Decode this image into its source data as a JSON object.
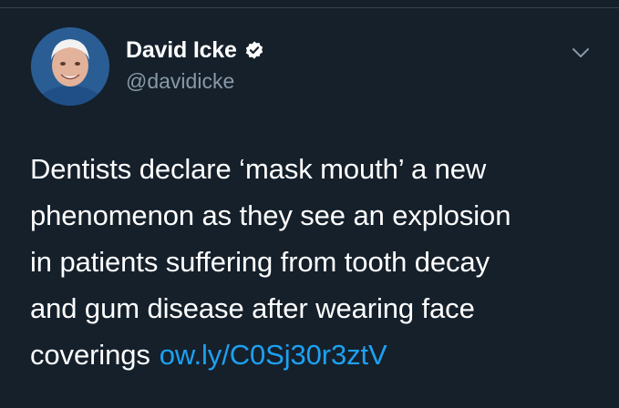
{
  "header": {
    "display_name": "David Icke",
    "handle": "@davidicke",
    "verified": true
  },
  "icons": {
    "avatar": "profile-photo",
    "verified": "verified-badge-icon",
    "menu": "chevron-down-icon"
  },
  "tweet": {
    "lines": [
      "Dentists declare ‘mask mouth’ a new",
      "phenomenon as they see an explosion",
      "in patients suffering from tooth decay",
      "and gum disease after wearing face"
    ],
    "last_line_text": "coverings",
    "link_text": "ow.ly/C0Sj30r3ztV"
  },
  "colors": {
    "background": "#15202b",
    "text": "#ffffff",
    "secondary_text": "#8899a6",
    "link": "#1da1f2",
    "divider": "#38444d"
  }
}
